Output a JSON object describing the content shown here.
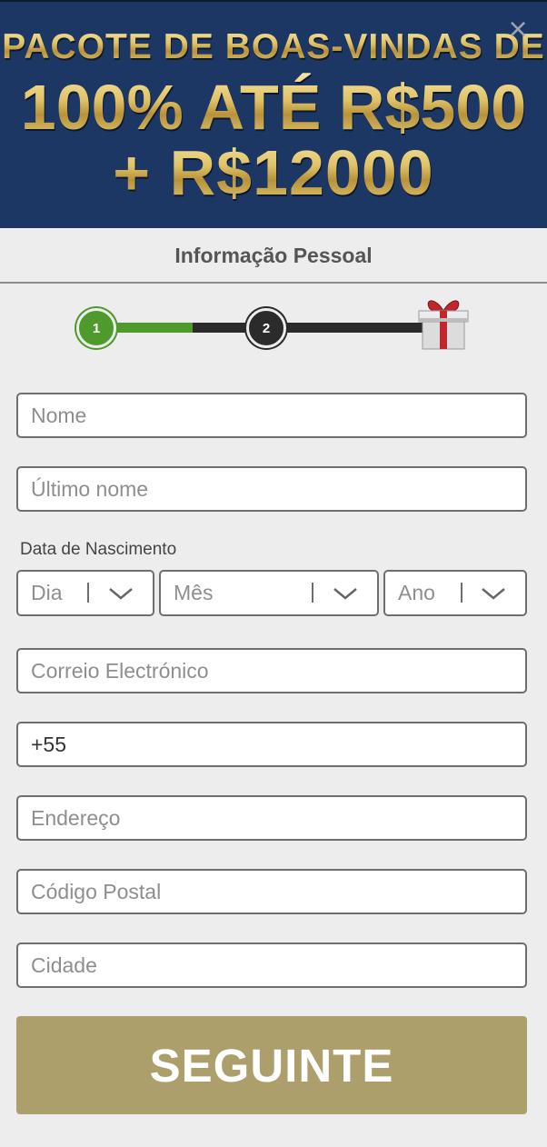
{
  "banner": {
    "line1": "PACOTE DE BOAS-VINDAS DE",
    "line2": "100% ATÉ  R$500",
    "line3": "+ R$12000",
    "close_label": "×"
  },
  "section_title": "Informação Pessoal",
  "progress": {
    "step1": "1",
    "step2": "2",
    "final_icon": "gift-icon",
    "colors": {
      "done": "#4e9a2c",
      "todo": "#2b2b2b"
    }
  },
  "form": {
    "first_name_placeholder": "Nome",
    "last_name_placeholder": "Último nome",
    "dob_label": "Data de Nascimento",
    "day_placeholder": "Dia",
    "month_placeholder": "Mês",
    "year_placeholder": "Ano",
    "email_placeholder": "Correio Electrónico",
    "phone_value": "+55",
    "address_placeholder": "Endereço",
    "postal_placeholder": "Código Postal",
    "city_placeholder": "Cidade",
    "submit_label": "SEGUINTE"
  },
  "colors": {
    "banner_bg": "#1c3763",
    "submit_bg": "#ac9f6c",
    "page_bg": "#ededed"
  }
}
